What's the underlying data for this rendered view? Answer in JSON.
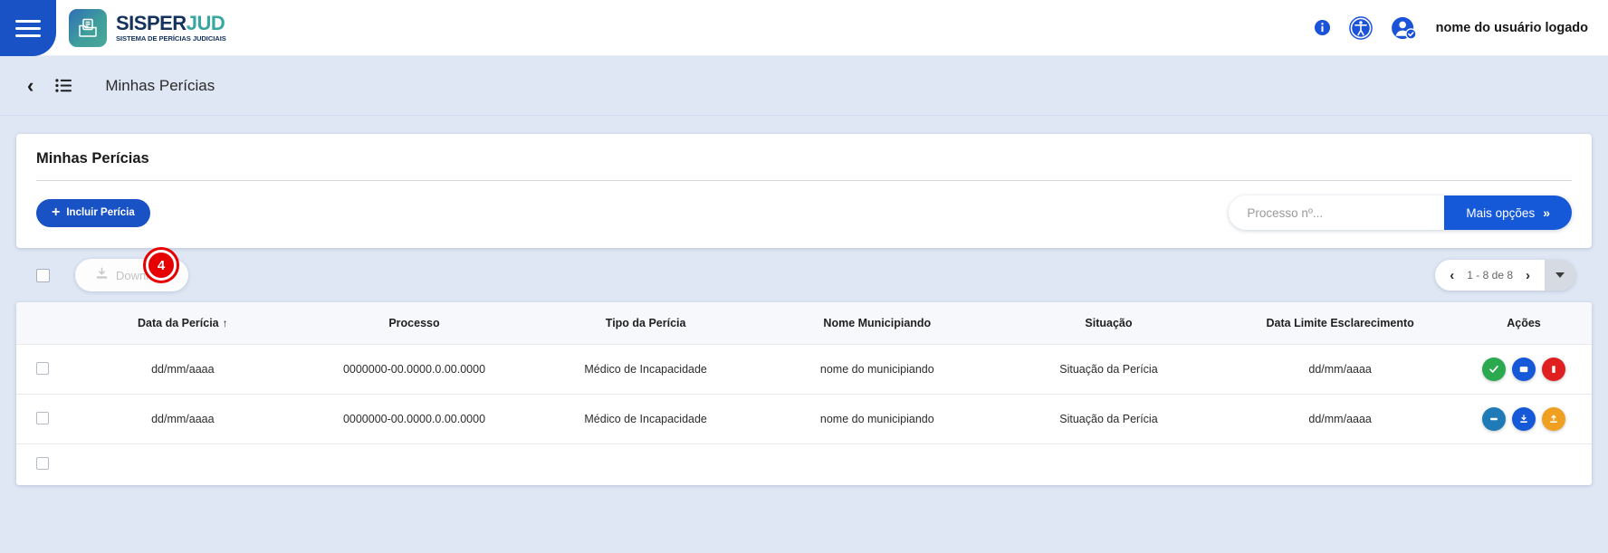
{
  "header": {
    "menu_icon": "hamburger-menu-icon",
    "logo": {
      "title_part1": "SISPER",
      "title_part2": "JUD",
      "subtitle": "SISTEMA DE PERÍCIAS JUDICIAIS",
      "mark_icon": "documents-folder-icon"
    },
    "info_icon": "info-icon",
    "accessibility_icon": "accessibility-icon",
    "avatar_icon": "user-avatar-verified-icon",
    "user_name": "nome do usuário logado"
  },
  "breadcrumb": {
    "back_icon": "chevron-left-icon",
    "list_icon": "list-icon",
    "title": "Minhas Perícias"
  },
  "card": {
    "title": "Minhas Perícias",
    "include_button": "Incluir Perícia",
    "include_plus": "+",
    "search_placeholder": "Processo nº...",
    "search_value": "",
    "more_options_button": "Mais opções",
    "more_options_chevron": "»"
  },
  "toolbar": {
    "select_all_checkbox": "",
    "download_button": "Download",
    "download_icon": "download-icon",
    "annotation_badge": "4",
    "pagination": {
      "prev_icon": "chevron-left-icon",
      "next_icon": "chevron-right-icon",
      "label": "1 - 8 de 8",
      "dropdown_icon": "caret-down-icon"
    }
  },
  "table": {
    "columns": [
      {
        "label": "",
        "key": "checkbox"
      },
      {
        "label": "Data da Perícia",
        "key": "data",
        "sort": "↑"
      },
      {
        "label": "Processo",
        "key": "processo"
      },
      {
        "label": "Tipo da Perícia",
        "key": "tipo"
      },
      {
        "label": "Nome Municipiando",
        "key": "nome"
      },
      {
        "label": "Situação",
        "key": "situacao"
      },
      {
        "label": "Data Limite Esclarecimento",
        "key": "limite"
      },
      {
        "label": "Ações",
        "key": "acoes"
      }
    ],
    "headers": {
      "c0": "",
      "c1": "Data da Perícia",
      "c1_sort": "↑",
      "c2": "Processo",
      "c3": "Tipo da Perícia",
      "c4": "Nome Municipiando",
      "c5": "Situação",
      "c6": "Data Limite Esclarecimento",
      "c7": "Ações"
    },
    "rows": [
      {
        "data": "dd/mm/aaaa",
        "processo": "0000000-00.0000.0.00.0000",
        "tipo": "Médico de Incapacidade",
        "nome": "nome do municipiando",
        "situacao": "Situação da Perícia",
        "limite": "dd/mm/aaaa",
        "actions": [
          {
            "name": "approve-action-button",
            "glyph": "✔",
            "color": "#2aa94f"
          },
          {
            "name": "message-action-button",
            "glyph": "▭",
            "color": "#1659d8"
          },
          {
            "name": "delete-action-button",
            "glyph": "▮",
            "color": "#e02020"
          }
        ]
      },
      {
        "data": "dd/mm/aaaa",
        "processo": "0000000-00.0000.0.00.0000",
        "tipo": "Médico de Incapacidade",
        "nome": "nome do municipiando",
        "situacao": "Situação da Perícia",
        "limite": "dd/mm/aaaa",
        "actions": [
          {
            "name": "edit-action-button",
            "glyph": "▬",
            "color": "#1f7ab8"
          },
          {
            "name": "download-action-button",
            "glyph": "⬇",
            "color": "#1659d8"
          },
          {
            "name": "upload-action-button",
            "glyph": "⬆",
            "color": "#f0a020"
          }
        ]
      },
      {
        "data": "",
        "processo": "",
        "tipo": "",
        "nome": "",
        "situacao": "",
        "limite": "",
        "actions": []
      }
    ]
  },
  "colors": {
    "brand_blue": "#1852c4",
    "accent_blue": "#1659d8",
    "page_bg": "#dfe7f5",
    "badge_red": "#e60000",
    "logo_teal": "#3aa6a0"
  }
}
